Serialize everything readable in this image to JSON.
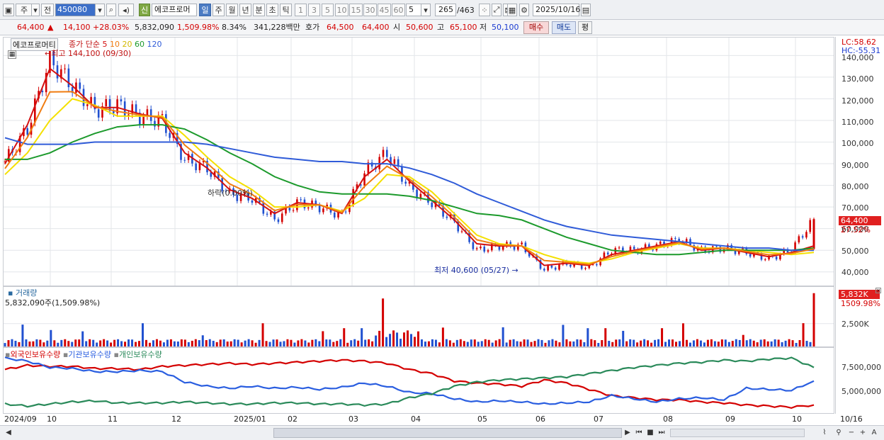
{
  "toolbar": {
    "period_select": "주",
    "prefix_label": "전",
    "stock_code": "450080",
    "new_badge": "신",
    "stock_name": "에코프로머",
    "period_tabs": [
      "일",
      "주",
      "월",
      "년",
      "분",
      "초",
      "틱"
    ],
    "active_period": "일",
    "interval_buttons": [
      "1",
      "3",
      "5",
      "10",
      "15",
      "30",
      "45",
      "60"
    ],
    "custom_interval": "5",
    "range_value": "265",
    "range_total": "/463",
    "date_value": "2025/10/16"
  },
  "quote": {
    "price": "64,400",
    "up_arrow": "▲",
    "change": "14,100",
    "change_pct": "+28.03%",
    "volume": "5,832,090",
    "volume_ratio": "1,509.98%",
    "turnover": "8.34%",
    "amount": "341,228백만",
    "ask_label": "호가",
    "ask_value": "64,500",
    "bid_value": "64,400",
    "open_label": "시",
    "open_value": "50,600",
    "high_label": "고",
    "high_value": "65,100",
    "low_label": "저",
    "low_value": "50,100",
    "buy_button": "매수",
    "sell_button": "매도",
    "eval_button": "평"
  },
  "price_pane": {
    "title": "에코프로머티",
    "ma_label": "종가 단순",
    "ma_periods": [
      "5",
      "10",
      "20",
      "60",
      "120"
    ],
    "ma_colors": [
      "#d41010",
      "#f07c10",
      "#f4e000",
      "#1c9a2c",
      "#2f5bd8"
    ],
    "high_annotation": "최고 144,100 (09/30)",
    "low_annotation": "최저 40,600 (05/27)",
    "bottom_annotation": "하락(0.00%)",
    "lc": "LC:58.62",
    "hc": "HC:-55.31",
    "last_price_tag": "64,400",
    "last_pct_tag": "27.52%",
    "y_ticks": [
      "140,000",
      "130,000",
      "120,000",
      "110,000",
      "100,000",
      "90,000",
      "80,000",
      "70,000",
      "60,000",
      "50,000",
      "40,000"
    ]
  },
  "volume_pane": {
    "title": "거래량",
    "value_text": "5,832,090주(1,509.98%)",
    "tag_value": "5,832K",
    "tag_pct": "1509.98%",
    "y_ticks": [
      "2,500K"
    ]
  },
  "holding_pane": {
    "series": [
      {
        "name": "외국인보유수량",
        "color": "#d40000"
      },
      {
        "name": "기관보유수량",
        "color": "#2a5ee0"
      },
      {
        "name": "개인보유수량",
        "color": "#2a8a5a"
      }
    ],
    "y_ticks": [
      "7,500,000",
      "5,000,000"
    ]
  },
  "date_axis": {
    "labels": [
      "2024/09",
      "10",
      "11",
      "12",
      "2025/01",
      "02",
      "03",
      "04",
      "05",
      "06",
      "07",
      "08",
      "09",
      "10"
    ],
    "right_label": "10/16"
  },
  "chart_data": {
    "type": "line",
    "title": "에코프로머티",
    "x_range": [
      "2024/09",
      "2025/10/16"
    ],
    "ylim": [
      35000,
      147000
    ],
    "price_points": [
      {
        "date": "2024/09/10",
        "close": 91000
      },
      {
        "date": "2024/09/20",
        "close": 106000
      },
      {
        "date": "2024/09/30",
        "close": 138000
      },
      {
        "date": "2024/10/10",
        "close": 126000
      },
      {
        "date": "2024/10/20",
        "close": 115000
      },
      {
        "date": "2024/11/01",
        "close": 117000
      },
      {
        "date": "2024/11/10",
        "close": 112000
      },
      {
        "date": "2024/11/20",
        "close": 110000
      },
      {
        "date": "2024/11/28",
        "close": 92000
      },
      {
        "date": "2024/12/10",
        "close": 88000
      },
      {
        "date": "2024/12/20",
        "close": 76000
      },
      {
        "date": "2025/01/02",
        "close": 74000
      },
      {
        "date": "2025/01/10",
        "close": 64000
      },
      {
        "date": "2025/01/20",
        "close": 72000
      },
      {
        "date": "2025/02/01",
        "close": 70000
      },
      {
        "date": "2025/02/10",
        "close": 66000
      },
      {
        "date": "2025/02/20",
        "close": 86000
      },
      {
        "date": "2025/02/27",
        "close": 95000
      },
      {
        "date": "2025/03/05",
        "close": 79000
      },
      {
        "date": "2025/03/20",
        "close": 72000
      },
      {
        "date": "2025/04/01",
        "close": 63000
      },
      {
        "date": "2025/04/10",
        "close": 50000
      },
      {
        "date": "2025/04/25",
        "close": 52000
      },
      {
        "date": "2025/05/10",
        "close": 52000
      },
      {
        "date": "2025/05/27",
        "close": 41000
      },
      {
        "date": "2025/06/10",
        "close": 44000
      },
      {
        "date": "2025/06/25",
        "close": 42000
      },
      {
        "date": "2025/07/10",
        "close": 50000
      },
      {
        "date": "2025/07/25",
        "close": 50000
      },
      {
        "date": "2025/08/10",
        "close": 52000
      },
      {
        "date": "2025/08/20",
        "close": 55000
      },
      {
        "date": "2025/09/01",
        "close": 50000
      },
      {
        "date": "2025/09/20",
        "close": 51000
      },
      {
        "date": "2025/10/01",
        "close": 49000
      },
      {
        "date": "2025/10/10",
        "close": 46000
      },
      {
        "date": "2025/10/15",
        "close": 50300
      },
      {
        "date": "2025/10/16",
        "close": 64400
      }
    ],
    "moving_averages": [
      {
        "period": "5",
        "values": [
          90000,
          108000,
          134000,
          126000,
          116000,
          116000,
          113000,
          111000,
          95000,
          88000,
          78000,
          74000,
          67000,
          72000,
          71000,
          67000,
          84000,
          92000,
          82000,
          73000,
          64000,
          53000,
          52000,
          52000,
          43000,
          44000,
          43000,
          48000,
          50000,
          52000,
          54000,
          50000,
          51000,
          49000,
          47000,
          49000,
          52000
        ]
      },
      {
        "period": "20",
        "values": [
          85000,
          95000,
          110000,
          120000,
          117000,
          112000,
          112000,
          112000,
          103000,
          93000,
          84000,
          78000,
          70000,
          70000,
          71000,
          68000,
          74000,
          85000,
          84000,
          77000,
          67000,
          57000,
          53000,
          52000,
          48000,
          45000,
          44000,
          46000,
          49000,
          51000,
          53000,
          51000,
          51000,
          50000,
          49000,
          48000,
          49000
        ]
      },
      {
        "period": "60",
        "values": [
          92000,
          92000,
          95000,
          100000,
          104000,
          107000,
          108000,
          108000,
          106000,
          101000,
          95000,
          90000,
          84000,
          80000,
          77000,
          76000,
          76000,
          76000,
          75000,
          73000,
          70000,
          67000,
          66000,
          64000,
          60000,
          56000,
          53000,
          50000,
          49000,
          48000,
          48000,
          49000,
          50000,
          50000,
          50000,
          50000,
          51000
        ]
      },
      {
        "period": "120",
        "values": [
          102000,
          99000,
          99000,
          99000,
          100000,
          100000,
          100000,
          100000,
          100000,
          99000,
          97000,
          95000,
          93000,
          92000,
          91000,
          91000,
          90000,
          90000,
          88000,
          85000,
          81000,
          76000,
          72000,
          68000,
          64000,
          61000,
          59000,
          57000,
          56000,
          55000,
          54000,
          53000,
          52000,
          51000,
          51000,
          50000,
          50000
        ]
      }
    ],
    "volume_series": {
      "name": "거래량",
      "last_value": 5832090,
      "ylim": [
        0,
        6200000
      ]
    },
    "holding_series": [
      {
        "name": "외국인보유수량",
        "values": [
          7400000,
          7800000,
          7700000,
          7700000,
          7500000,
          7500000,
          7400000,
          7700000,
          7800000,
          7900000,
          8000000,
          7900000,
          8000000,
          8100000,
          8200000,
          8300000,
          8200000,
          8000000,
          7400000,
          7000000,
          6300000,
          6100000,
          6000000,
          5800000,
          6400000,
          6100000,
          5500000,
          4900000,
          4700000,
          4500000,
          4500000,
          4300000,
          4200000,
          4000000,
          3900000,
          3800000,
          4000000
        ]
      },
      {
        "name": "기관보유수량",
        "values": [
          8500000,
          8200000,
          7600000,
          7500000,
          7200000,
          7200000,
          7300000,
          7200000,
          6200000,
          5800000,
          5600000,
          5800000,
          5600000,
          5700000,
          5500000,
          5700000,
          6100000,
          5800000,
          5200000,
          5100000,
          4600000,
          4300000,
          4400000,
          4300000,
          4100000,
          4200000,
          4300000,
          4900000,
          4600000,
          4300000,
          4600000,
          4700000,
          4500000,
          5600000,
          5500000,
          5400000,
          6300000
        ]
      },
      {
        "name": "개인보유수량",
        "values": [
          4100000,
          3900000,
          4100000,
          4300000,
          4400000,
          4200000,
          4200000,
          4200000,
          4300000,
          4200000,
          4100000,
          4100000,
          4200000,
          4200000,
          4100000,
          4100000,
          4000000,
          4100000,
          4700000,
          5100000,
          5800000,
          6200000,
          6400000,
          6500000,
          6600000,
          6700000,
          7000000,
          7300000,
          7600000,
          7800000,
          8000000,
          8100000,
          8300000,
          8200000,
          8400000,
          8500000,
          7600000
        ]
      }
    ],
    "holding_ylim": [
      3500000,
      9200000
    ]
  }
}
